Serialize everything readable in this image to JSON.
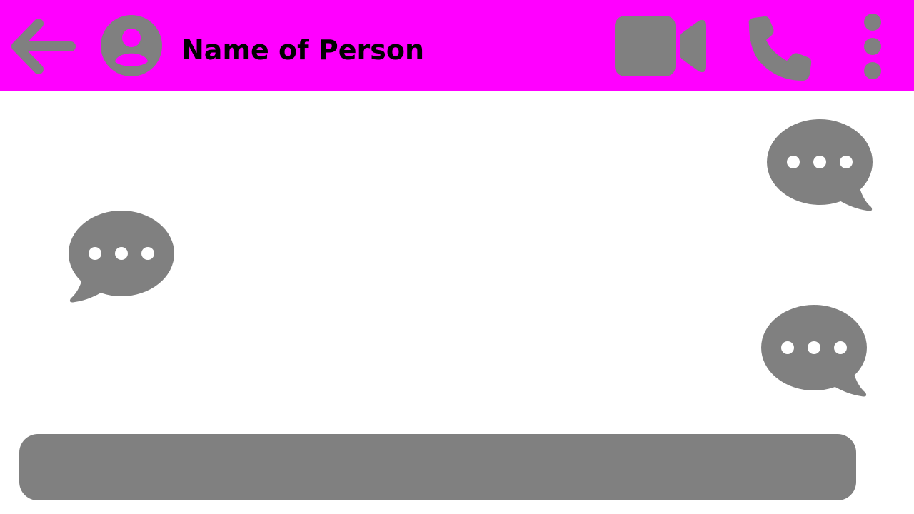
{
  "header": {
    "contact_name": "Name of Person",
    "background_color": "#ff00ff",
    "back_icon": "back-arrow-icon",
    "avatar_icon": "user-avatar-icon",
    "video_icon": "video-call-icon",
    "phone_icon": "phone-call-icon",
    "menu_icon": "more-vertical-icon"
  },
  "conversation": {
    "messages": [
      {
        "side": "right",
        "icon": "typing-bubble-icon"
      },
      {
        "side": "left",
        "icon": "typing-bubble-icon"
      },
      {
        "side": "right",
        "icon": "typing-bubble-icon"
      }
    ]
  },
  "composer": {
    "placeholder": ""
  },
  "colors": {
    "icon_gray": "#808080",
    "bubble_dots": "#ffffff",
    "title_text": "#000000"
  }
}
